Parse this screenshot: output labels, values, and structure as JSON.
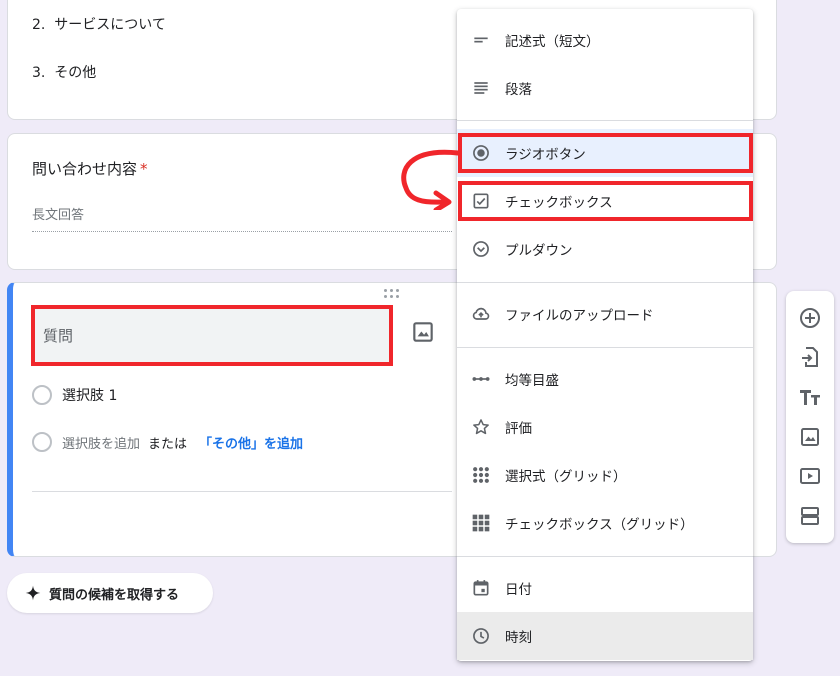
{
  "top_card": {
    "options": [
      {
        "num": "2.",
        "text": "サービスについて"
      },
      {
        "num": "3.",
        "text": "その他"
      }
    ]
  },
  "inquiry_question": {
    "title": "問い合わせ内容",
    "required_mark": "*",
    "answer_placeholder": "長文回答"
  },
  "active_question": {
    "question_placeholder": "質問",
    "choice1": "選択肢 1",
    "add_choice": "選択肢を追加",
    "or_text": "または",
    "add_other": "「その他」を追加"
  },
  "suggest_button": {
    "label": "質問の候補を取得する"
  },
  "type_menu": {
    "items": [
      {
        "label": "記述式（短文）",
        "icon": "short-answer-icon"
      },
      {
        "label": "段落",
        "icon": "paragraph-icon"
      },
      {
        "label": "ラジオボタン",
        "icon": "radio-button-icon"
      },
      {
        "label": "チェックボックス",
        "icon": "checkbox-icon"
      },
      {
        "label": "プルダウン",
        "icon": "dropdown-icon"
      },
      {
        "label": "ファイルのアップロード",
        "icon": "cloud-upload-icon"
      },
      {
        "label": "均等目盛",
        "icon": "linear-scale-icon"
      },
      {
        "label": "評価",
        "icon": "star-icon"
      },
      {
        "label": "選択式（グリッド）",
        "icon": "grid-dots-icon"
      },
      {
        "label": "チェックボックス（グリッド）",
        "icon": "grid-squares-icon"
      },
      {
        "label": "日付",
        "icon": "calendar-icon"
      },
      {
        "label": "時刻",
        "icon": "clock-icon"
      }
    ],
    "selected_index": 2
  },
  "colors": {
    "accent": "#4285f4",
    "highlight": "#f0262b",
    "link": "#1a73e8",
    "required": "#d93025"
  }
}
